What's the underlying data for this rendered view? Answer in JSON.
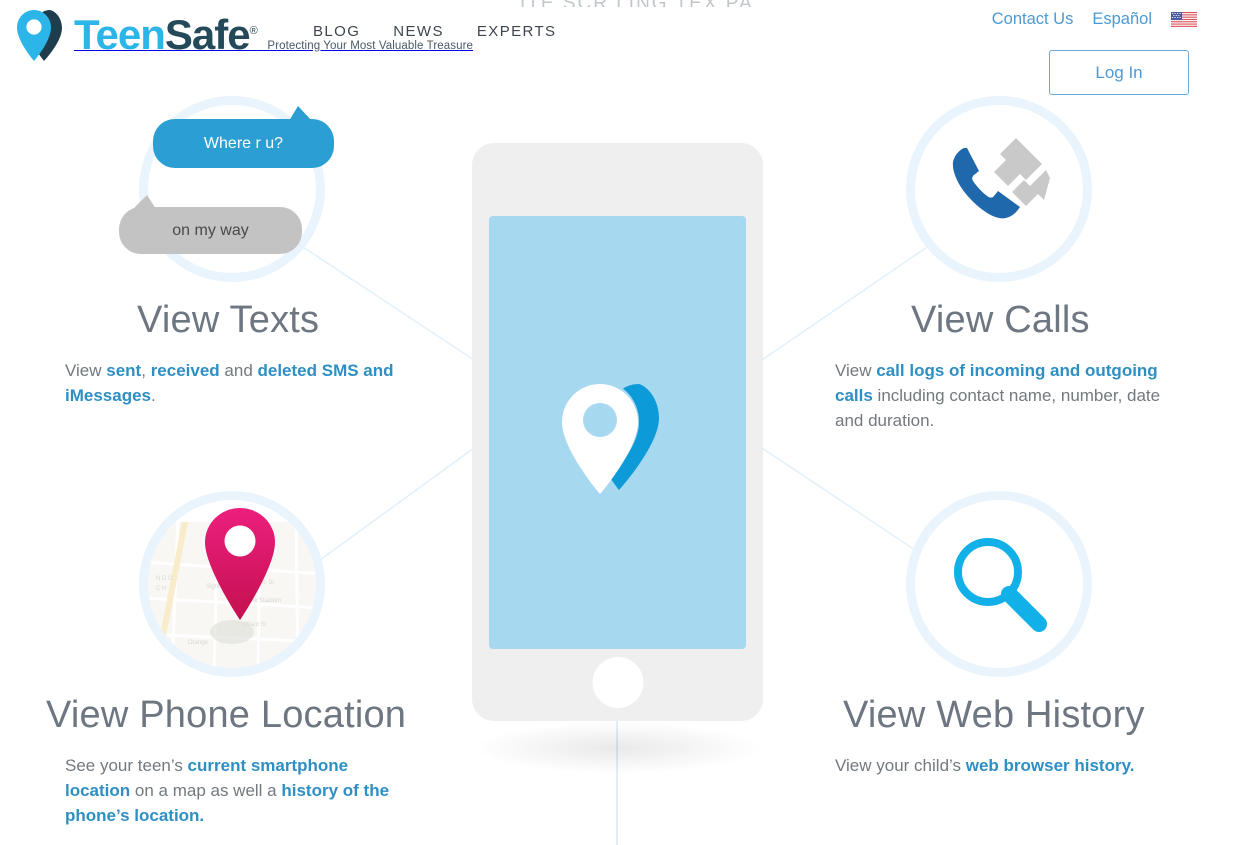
{
  "brand": {
    "name_part1": "Teen",
    "name_part2": "Safe",
    "registered": "®",
    "tagline": "Protecting Your Most Valuable Treasure",
    "logo_icon": "location-pin-logo-icon",
    "colors": {
      "cyan": "#2cb5e8",
      "navy": "#244a5a",
      "link_blue": "#4c9ad4",
      "accent_blue": "#2e8fc4",
      "bubble_blue": "#2b9fd4",
      "bubble_gray": "#c3c3c3",
      "pin_pink": "#e0176b",
      "ring_blue": "#eaf4fc",
      "screen_blue": "#a6d8ef",
      "phone_body": "#efefef"
    }
  },
  "scrolled_strip": "ITE SCR LING TEX PA",
  "nav": {
    "items": [
      {
        "label": "BLOG"
      },
      {
        "label": "NEWS"
      },
      {
        "label": "EXPERTS"
      }
    ]
  },
  "topbar": {
    "contact_label": "Contact Us",
    "language_label": "Español",
    "flag_icon": "us-flag-icon",
    "login_label": "Log In"
  },
  "phone": {
    "screen_icon": "teensafe-pin-logo-icon",
    "home_button": "home-button"
  },
  "messages": {
    "outgoing": "Where r u?",
    "incoming": "on my way"
  },
  "features": [
    {
      "id": "texts",
      "icon": "chat-bubbles-icon",
      "title": "View Texts",
      "body_html": "View <b>sent</b>, <b>received</b> and <b>deleted SMS and iMessages</b>."
    },
    {
      "id": "calls",
      "icon": "phone-call-logs-icon",
      "title": "View Calls",
      "body_html": "View <b>call logs of incoming and outgoing calls</b> including contact name, number, date and duration."
    },
    {
      "id": "location",
      "icon": "map-pin-location-icon",
      "title": "View Phone Location",
      "body_html": "See your teen&rsquo;s <b>current smartphone location</b> on a map as well a <b>history of the phone&rsquo;s location.</b>"
    },
    {
      "id": "web",
      "icon": "magnifying-glass-icon",
      "title": "View Web History",
      "body_html": "View your child&rsquo;s <b>web browser history.</b>"
    }
  ]
}
